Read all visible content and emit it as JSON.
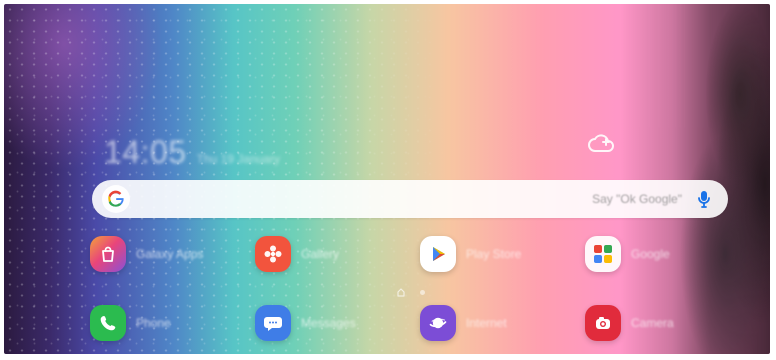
{
  "home": {
    "clock": {
      "time": "14:05",
      "subtitle": "Thu 19 January"
    },
    "search": {
      "placeholder": "",
      "hint": "Say \"Ok Google\""
    },
    "apps": [
      {
        "label": "Galaxy Apps",
        "icon": "galaxy-apps-icon"
      },
      {
        "label": "Gallery",
        "icon": "gallery-icon"
      },
      {
        "label": "Play Store",
        "icon": "play-store-icon"
      },
      {
        "label": "Google",
        "icon": "google-folder-icon"
      },
      {
        "label": "Phone",
        "icon": "phone-icon"
      },
      {
        "label": "Messages",
        "icon": "messages-icon"
      },
      {
        "label": "Internet",
        "icon": "internet-icon"
      },
      {
        "label": "Camera",
        "icon": "camera-icon"
      }
    ]
  },
  "colors": {
    "accent_blue": "#1a73e8",
    "galaxy_apps_pink": "#e9457a",
    "gallery_red": "#f2543d",
    "phone_green": "#2bbb4f",
    "messages_blue": "#3f7de7",
    "internet_purple": "#7c4dd6",
    "camera_red": "#e12b3c"
  }
}
